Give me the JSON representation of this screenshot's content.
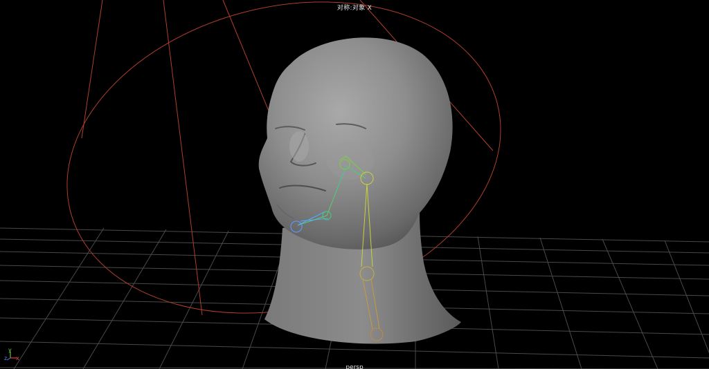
{
  "viewport": {
    "symmetry_label": "对称:对象 X",
    "camera_label": "persp",
    "background": "#000000",
    "grid_color": "#4a4a4a",
    "curve_color": "#b0402a"
  },
  "axis_gizmo": {
    "y": "y",
    "x": "x",
    "z": "z",
    "colors": {
      "x": "#ff4d4d",
      "y": "#6fdc4a",
      "z": "#5a7dff"
    }
  },
  "objects": {
    "head_mesh": "head-mesh",
    "skeleton_neck": "neck-joint-chain",
    "skeleton_jaw": "jaw-joint-chain",
    "control_curve": "circle-control-curve",
    "camera_lines": "camera-frustum-lines"
  }
}
